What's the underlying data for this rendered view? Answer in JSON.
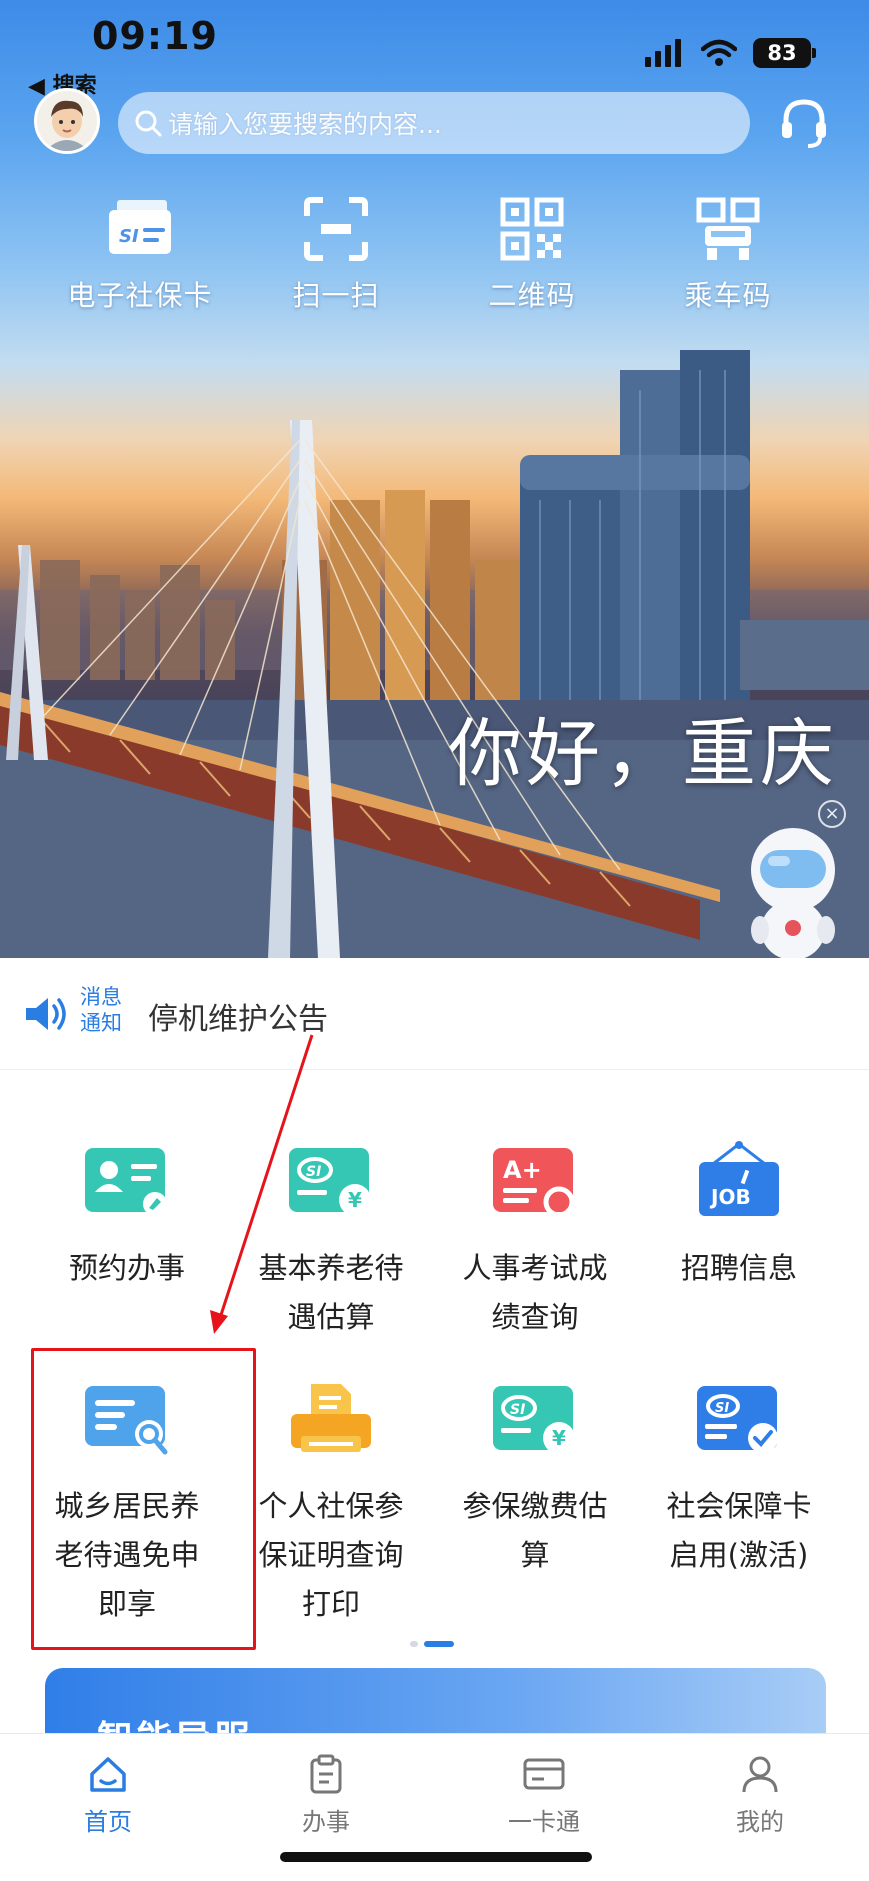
{
  "status_bar": {
    "time": "09:19",
    "back_label": "◀ 搜索",
    "battery": "83",
    "icons": [
      "signal-icon",
      "wifi-icon",
      "battery-icon"
    ]
  },
  "header": {
    "search_placeholder": "请输入您要搜索的内容...",
    "avatar": "avatar",
    "service_icon": "headset-icon"
  },
  "quick_actions": [
    {
      "label": "电子社保卡",
      "icon": "social-security-card-icon"
    },
    {
      "label": "扫一扫",
      "icon": "scan-icon"
    },
    {
      "label": "二维码",
      "icon": "qr-code-icon"
    },
    {
      "label": "乘车码",
      "icon": "bus-code-icon"
    }
  ],
  "banner": {
    "greeting": "你好，重庆",
    "close": "×"
  },
  "notice": {
    "tag_line1": "消息",
    "tag_line2": "通知",
    "text": "停机维护公告"
  },
  "services": [
    {
      "line1": "预约办事",
      "line2": "",
      "line3": "",
      "icon": "appointment-icon"
    },
    {
      "line1": "基本养老待",
      "line2": "遇估算",
      "line3": "",
      "icon": "pension-estimate-icon"
    },
    {
      "line1": "人事考试成",
      "line2": "绩查询",
      "line3": "",
      "icon": "exam-score-icon"
    },
    {
      "line1": "招聘信息",
      "line2": "",
      "line3": "",
      "icon": "job-icon"
    },
    {
      "line1": "城乡居民养",
      "line2": "老待遇免申",
      "line3": "即享",
      "icon": "document-search-icon"
    },
    {
      "line1": "个人社保参",
      "line2": "保证明查询",
      "line3": "打印",
      "icon": "printer-icon"
    },
    {
      "line1": "参保缴费估",
      "line2": "算",
      "line3": "",
      "icon": "payment-estimate-icon"
    },
    {
      "line1": "社会保障卡",
      "line2": "启用(激活)",
      "line3": "",
      "icon": "card-activate-icon"
    }
  ],
  "promo_banner": {
    "title": "智能导服"
  },
  "tab_bar": [
    {
      "label": "首页",
      "icon": "home-icon",
      "active": true
    },
    {
      "label": "办事",
      "icon": "clipboard-icon",
      "active": false
    },
    {
      "label": "一卡通",
      "icon": "card-icon",
      "active": false
    },
    {
      "label": "我的",
      "icon": "user-icon",
      "active": false
    }
  ],
  "colors": {
    "accent": "#2a7de1",
    "highlight": "#e5141b",
    "icon_green": "#35c7b4",
    "icon_orange": "#f5a524",
    "icon_red": "#f0555a",
    "icon_blue": "#2f7ee8"
  }
}
